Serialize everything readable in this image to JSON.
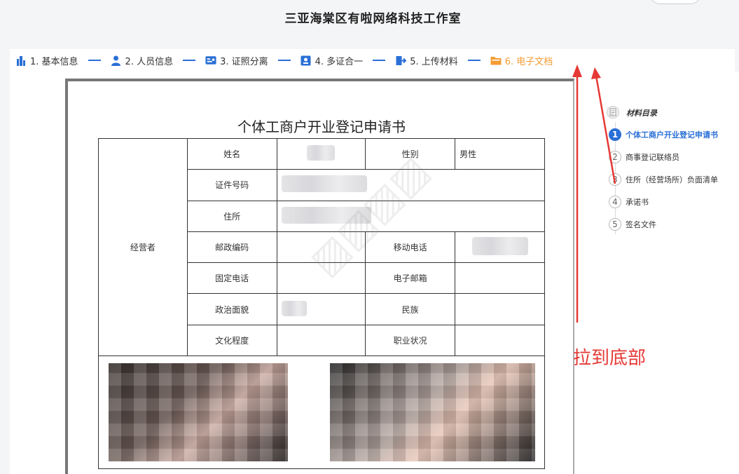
{
  "header": {
    "title": "三亚海棠区有啦网络科技工作室"
  },
  "steps": [
    {
      "label": "1. 基本信息",
      "icon": "building-icon",
      "color": "#2a6fd6"
    },
    {
      "label": "2. 人员信息",
      "icon": "person-icon",
      "color": "#2a6fd6"
    },
    {
      "label": "3. 证照分离",
      "icon": "id-card-icon",
      "color": "#2a6fd6"
    },
    {
      "label": "4. 多证合一",
      "icon": "certificate-icon",
      "color": "#2a6fd6"
    },
    {
      "label": "5. 上传材料",
      "icon": "upload-icon",
      "color": "#2a6fd6"
    },
    {
      "label": "6. 电子文档",
      "icon": "folder-icon",
      "color": "#f39c34"
    }
  ],
  "document": {
    "title": "个体工商户开业登记申请书",
    "section_label": "经营者",
    "rows": [
      {
        "label1": "姓名",
        "label2": "性别",
        "value2": "男性"
      },
      {
        "label1": "证件号码"
      },
      {
        "label1": "住所"
      },
      {
        "label1": "邮政编码",
        "label2": "移动电话"
      },
      {
        "label1": "固定电话",
        "label2": "电子邮箱"
      },
      {
        "label1": "政治面貌",
        "label2": "民族"
      },
      {
        "label1": "文化程度",
        "label2": "职业状况"
      }
    ]
  },
  "catalog": {
    "title": "材料目录",
    "items": [
      {
        "num": "1",
        "label": "个体工商户开业登记申请书"
      },
      {
        "num": "2",
        "label": "商事登记联络员"
      },
      {
        "num": "3",
        "label": "住所（经营场所）负面清单"
      },
      {
        "num": "4",
        "label": "承诺书"
      },
      {
        "num": "5",
        "label": "签名文件"
      }
    ]
  },
  "annotation": {
    "text": "拉到底部",
    "color": "#e53935"
  },
  "colors": {
    "accent": "#2a6fd6",
    "active_step": "#f39c34"
  }
}
